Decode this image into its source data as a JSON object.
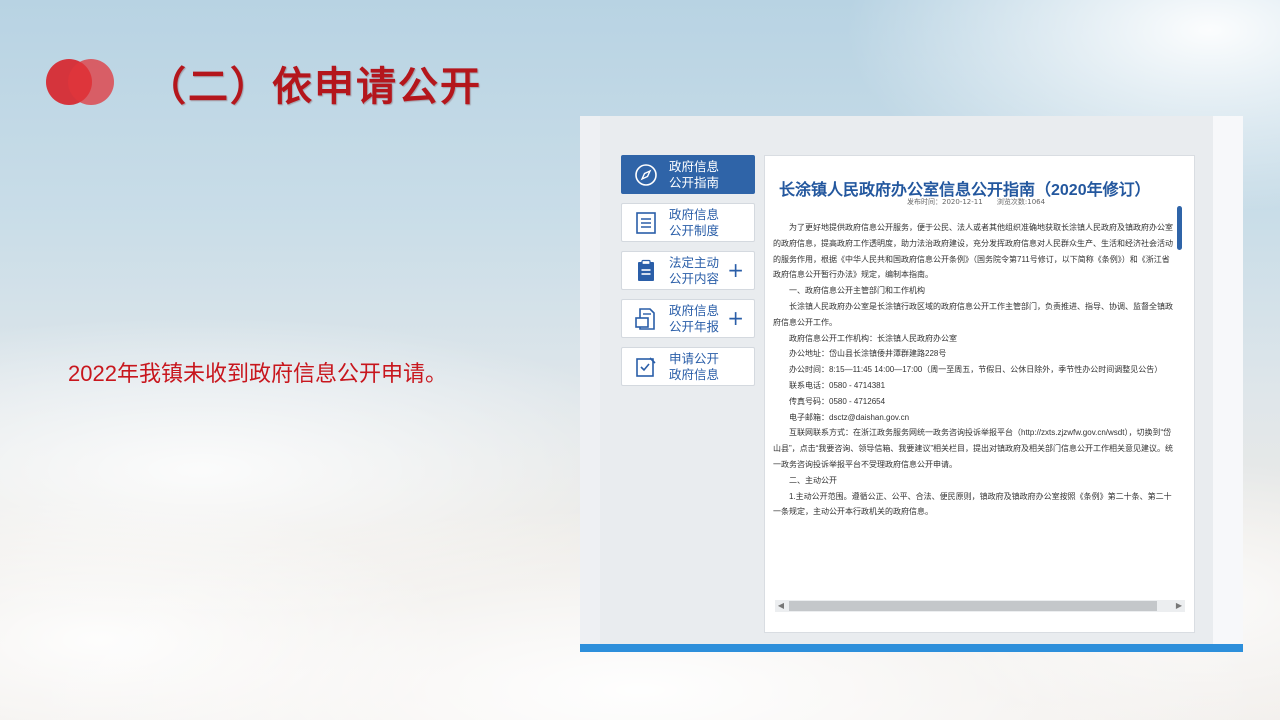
{
  "slide": {
    "title": "（二）依申请公开",
    "body": "2022年我镇未收到政府信息公开申请。"
  },
  "colors": {
    "title_red": "#b4161c",
    "circle_red": "#d7262e",
    "nav_active_blue": "#2f64a8",
    "link_blue": "#2a5ea8",
    "bottom_bar_blue": "#2d8fdb"
  },
  "nav": {
    "items": [
      {
        "label": "政府信息公开指南",
        "icon": "compass-icon",
        "active": true,
        "expandable": false
      },
      {
        "label": "政府信息公开制度",
        "icon": "list-document-icon",
        "active": false,
        "expandable": false
      },
      {
        "label": "法定主动公开内容",
        "icon": "clipboard-icon",
        "active": false,
        "expandable": true
      },
      {
        "label": "政府信息公开年报",
        "icon": "report-document-icon",
        "active": false,
        "expandable": true
      },
      {
        "label": "申请公开政府信息",
        "icon": "checkbox-edit-icon",
        "active": false,
        "expandable": false
      }
    ],
    "plus_symbol": "+"
  },
  "doc": {
    "title": "长涂镇人民政府办公室信息公开指南（2020年修订）",
    "publish_time": "发布时间：2020-12-11",
    "views": "浏览次数:1064",
    "paragraphs": [
      "为了更好地提供政府信息公开服务，便于公民、法人或者其他组织准确地获取长涂镇人民政府及镇政府办公室的政府信息，提高政府工作透明度，助力法治政府建设，充分发挥政府信息对人民群众生产、生活和经济社会活动的服务作用，根据《中华人民共和国政府信息公开条例》（国务院令第711号修订，以下简称《条例》）和《浙江省政府信息公开暂行办法》规定，编制本指南。",
      "一、政府信息公开主管部门和工作机构",
      "长涂镇人民政府办公室是长涂镇行政区域的政府信息公开工作主管部门，负责推进、指导、协调、监督全镇政府信息公开工作。",
      "政府信息公开工作机构：长涂镇人民政府办公室",
      "办公地址：岱山县长涂镇倭井潭群建路228号",
      "办公时间：8:15—11:45 14:00—17:00（周一至周五，节假日、公休日除外，季节性办公时间调整见公告）",
      "联系电话：0580 - 4714381",
      "传真号码：0580 - 4712654",
      "电子邮箱：dsctz@daishan.gov.cn",
      "互联网联系方式：在浙江政务服务网统一政务咨询投诉举报平台（http://zxts.zjzwfw.gov.cn/wsdt），切换到“岱山县”，点击“我要咨询、领导信箱、我要建议”相关栏目，提出对镇政府及相关部门信息公开工作相关意见建议。统一政务咨询投诉举报平台不受理政府信息公开申请。",
      "二、主动公开",
      "1.主动公开范围。遵循公正、公平、合法、便民原则，镇政府及镇政府办公室按照《条例》第二十条、第二十一条规定，主动公开本行政机关的政府信息。"
    ],
    "scroll_left": "◀",
    "scroll_right": "▶"
  }
}
